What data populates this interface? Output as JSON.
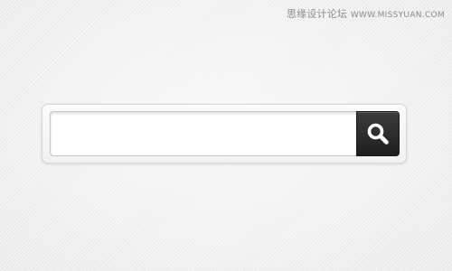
{
  "watermark": {
    "text": "思缘设计论坛",
    "site": "WWW.MISSYUAN.COM"
  },
  "search": {
    "value": "",
    "placeholder": "",
    "button_icon": "search-icon"
  },
  "colors": {
    "background": "#f2f2f2",
    "button": "#2a2a2a",
    "icon": "#ffffff"
  }
}
